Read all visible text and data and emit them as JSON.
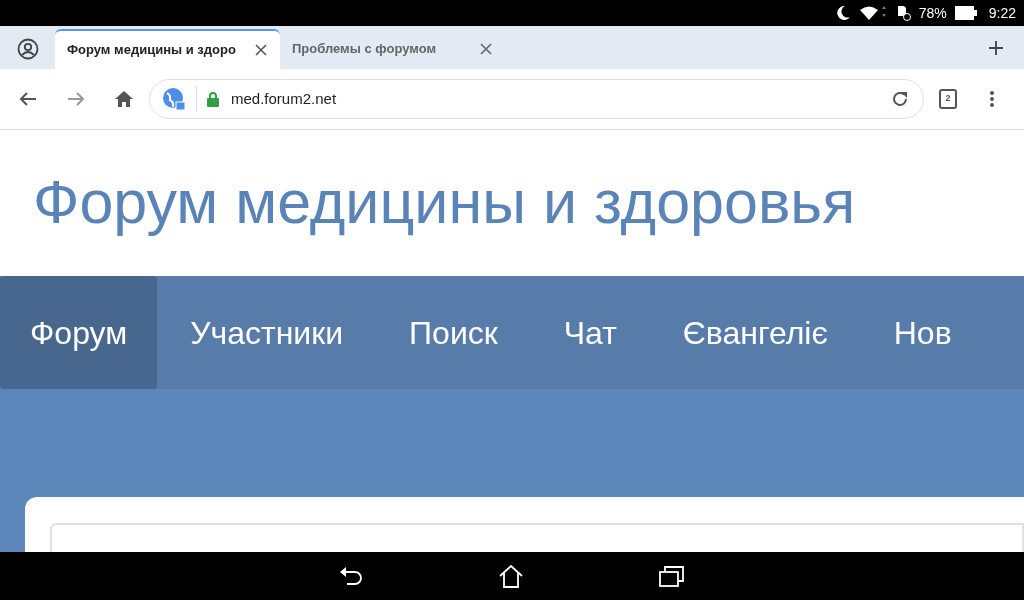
{
  "status_bar": {
    "battery": "78%",
    "time": "9:22"
  },
  "tabs": [
    {
      "label": "Форум медицины и здоро",
      "selected": true
    },
    {
      "label": "Проблемы с форумом",
      "selected": false
    }
  ],
  "address_bar": {
    "url": "med.forum2.net",
    "tab_count": "2"
  },
  "site": {
    "title": "Форум медицины и здоровья"
  },
  "nav": [
    {
      "label": "Форум",
      "selected": true
    },
    {
      "label": "Участники",
      "selected": false
    },
    {
      "label": "Поиск",
      "selected": false
    },
    {
      "label": "Чат",
      "selected": false
    },
    {
      "label": "Євангеліє",
      "selected": false
    },
    {
      "label": "Нов",
      "selected": false
    }
  ]
}
